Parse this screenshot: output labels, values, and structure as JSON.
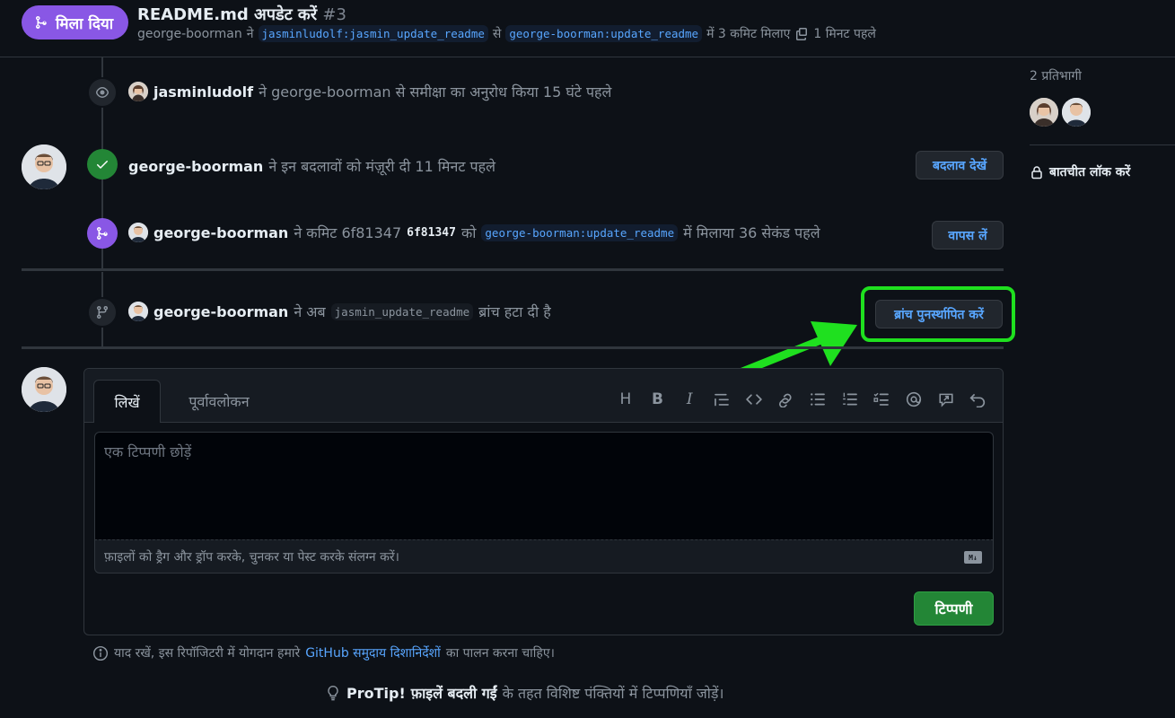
{
  "header": {
    "status_label": "मिला दिया",
    "title": "README.md अपडेट करें",
    "number": "#3",
    "author": "george-boorman",
    "word_ne": "ने",
    "head_branch": "jasminludolf:jasmin_update_readme",
    "word_se": "से",
    "base_branch": "george-boorman:update_readme",
    "merge_text": "में 3 कमिट मिलाए",
    "time": "1 मिनट पहले"
  },
  "timeline": {
    "review_request": {
      "user": "jasminludolf",
      "text": "ने george-boorman से समीक्षा का अनुरोध किया 15 घंटे पहले"
    },
    "approval": {
      "user": "george-boorman",
      "text": "ने इन बदलावों को मंज़ूरी दी 11 मिनट पहले",
      "button": "बदलाव देखें"
    },
    "merge": {
      "user": "george-boorman",
      "text_a": "ने कमिट 6f81347",
      "commit": "6f81347",
      "text_b": "को",
      "branch": "george-boorman:update_readme",
      "text_c": "में मिलाया 36 सेकंड पहले",
      "button": "वापस लें"
    },
    "branch_deleted": {
      "user": "george-boorman",
      "text_a": "ने अब",
      "branch": "jasmin_update_readme",
      "text_b": "ब्रांच हटा दी है",
      "button": "ब्रांच पुनर्स्थापित करें"
    }
  },
  "comment": {
    "tab_write": "लिखें",
    "tab_preview": "पूर्वावलोकन",
    "toolbar": [
      "heading-icon",
      "bold-icon",
      "italic-icon",
      "quote-icon",
      "code-icon",
      "link-icon",
      "bullet-list-icon",
      "numbered-list-icon",
      "task-list-icon",
      "mention-icon",
      "reference-icon",
      "undo-icon"
    ],
    "toolbar_glyphs": {
      "heading": "H",
      "bold": "B",
      "italic": "I"
    },
    "placeholder": "एक टिप्पणी छोड़ें",
    "attach_text": "फ़ाइलों को ड्रैग और ड्रॉप करके, चुनकर या पेस्ट करके संलग्न करें।",
    "md_badge": "M↓",
    "submit": "टिप्पणी"
  },
  "sidebar": {
    "participants_label": "2 प्रतिभागी",
    "lock_label": "बातचीत लॉक करें"
  },
  "footer": {
    "note_a": "याद रखें, इस रिपॉजिटरी में योगदान हमारे",
    "note_link": "GitHub समुदाय दिशानिर्देशों",
    "note_b": "का पालन करना चाहिए।",
    "protip_a": "ProTip!",
    "protip_b": "फ़ाइलें बदली गईं",
    "protip_c": "के तहत विशिष्ट पंक्तियों में टिप्पणियाँ जोड़ें।"
  },
  "colors": {
    "merged": "#8957e5",
    "approved": "#238636",
    "highlight": "#1fe01f",
    "link": "#58a6ff"
  }
}
